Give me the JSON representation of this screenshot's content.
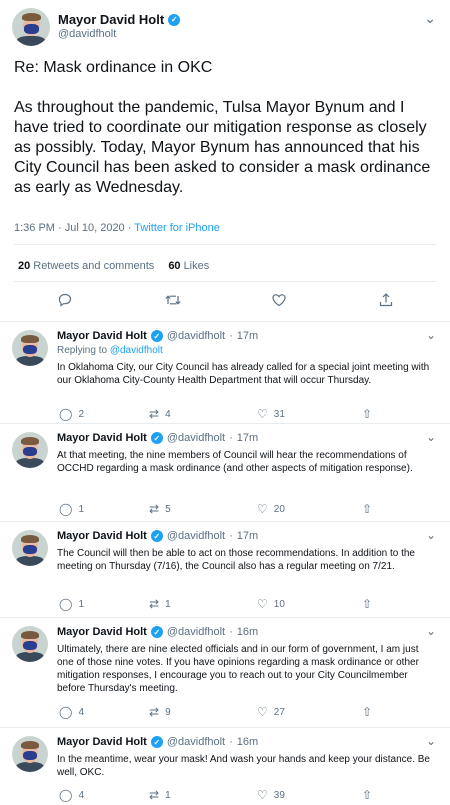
{
  "author": {
    "name": "Mayor David Holt",
    "handle": "@davidfholt"
  },
  "main_tweet": {
    "text": "Re: Mask ordinance in OKC\n\nAs throughout the pandemic, Tulsa Mayor Bynum and I have tried to coordinate our mitigation response as closely as possibly.  Today, Mayor Bynum has announced that his City Council has been asked to consider a mask ordinance as early as Wednesday.",
    "timestamp": "1:36 PM · Jul 10, 2020 · ",
    "source": "Twitter for iPhone",
    "retweets_count": "20",
    "retweets_label": "Retweets and comments",
    "likes_count": "60",
    "likes_label": "Likes"
  },
  "replies": [
    {
      "time": "17m",
      "replying_prefix": "Replying to ",
      "replying_to": "@davidfholt",
      "text": "In Oklahoma City, our City Council has already called for a special joint meeting with our Oklahoma City-County Health Department that will occur Thursday.",
      "comments": "2",
      "retweets": "4",
      "likes": "31"
    },
    {
      "time": "17m",
      "text": "At that meeting, the nine members of Council will hear the recommendations of OCCHD regarding a mask ordinance (and other aspects of mitigation response).",
      "comments": "1",
      "retweets": "5",
      "likes": "20"
    },
    {
      "time": "17m",
      "text": "The Council will then be able to act on those recommendations.  In addition to the meeting on Thursday (7/16), the Council also has a regular meeting on 7/21.",
      "comments": "1",
      "retweets": "1",
      "likes": "10"
    },
    {
      "time": "16m",
      "text": "Ultimately, there are nine elected officials and in our form of government, I am just one of those nine votes.  If you have opinions regarding a mask ordinance or other mitigation responses, I encourage you to reach out to your City Councilmember before Thursday's meeting.",
      "comments": "4",
      "retweets": "9",
      "likes": "27"
    },
    {
      "time": "16m",
      "text": "In the meantime, wear your mask!  And wash your hands and keep your distance. Be well, OKC.",
      "comments": "4",
      "retweets": "1",
      "likes": "39"
    }
  ],
  "icons": {
    "comment": "comment-icon",
    "retweet": "retweet-icon",
    "like": "heart-icon",
    "share": "share-icon",
    "more": "chevron-down-icon",
    "verified": "verified-badge-icon"
  },
  "colors": {
    "accent": "#1da1f2",
    "secondary_text": "#5b7083",
    "border": "#e6ecf0",
    "mask": "#2b3d8f"
  }
}
